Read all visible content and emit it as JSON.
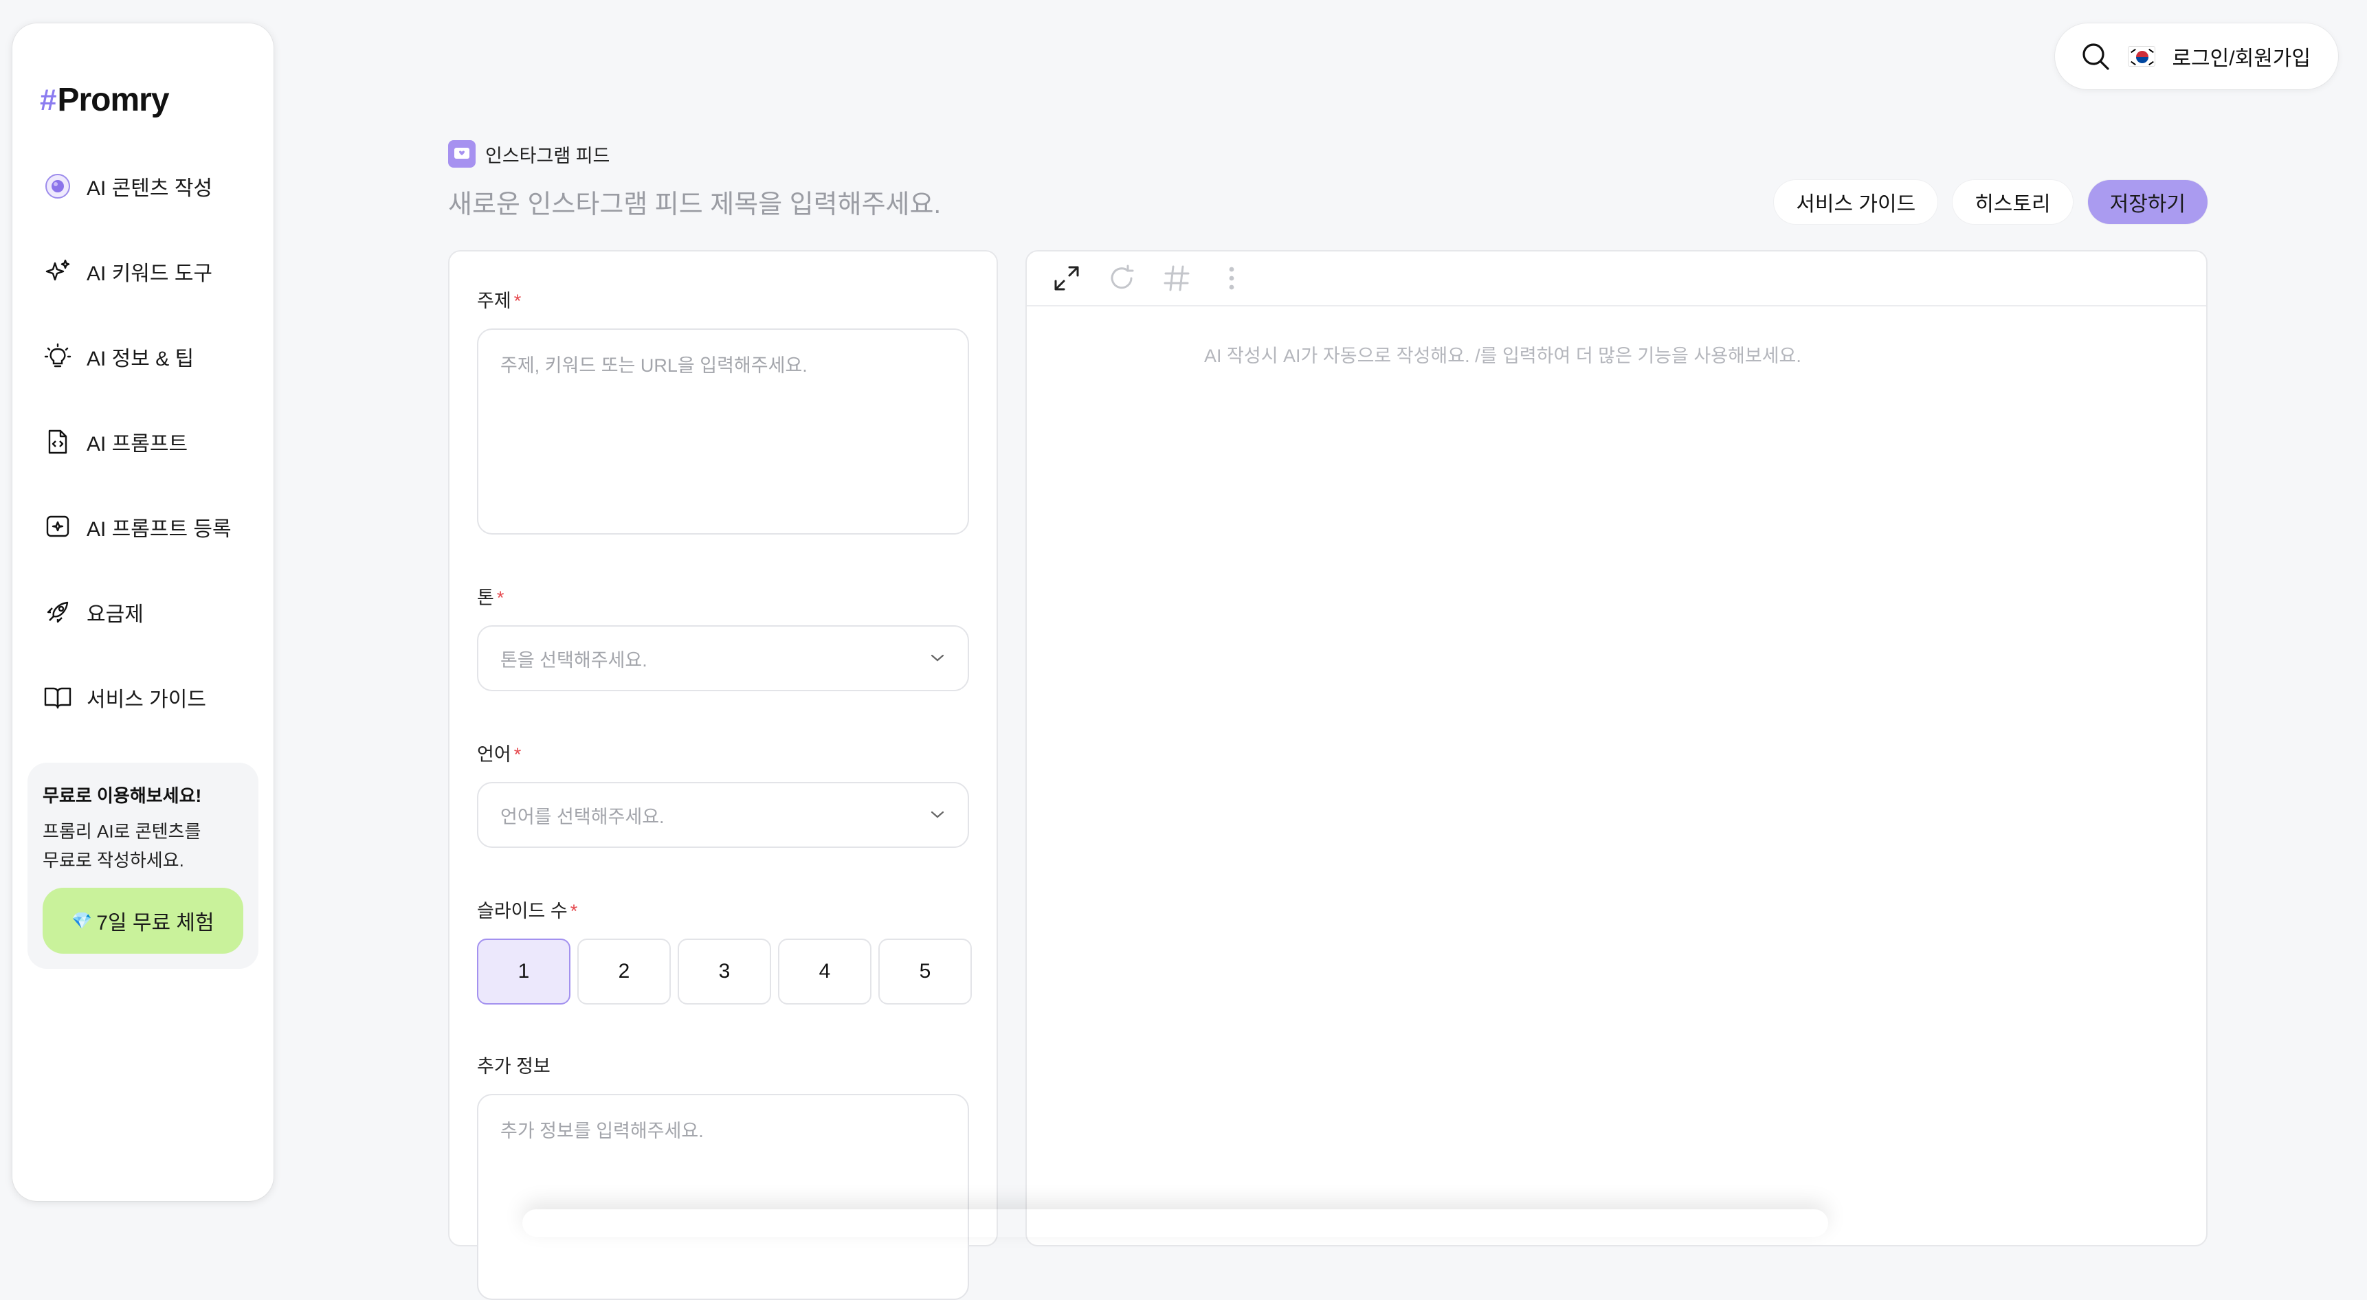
{
  "brand": {
    "hash": "#",
    "name": "Promry"
  },
  "sidebar": {
    "items": [
      {
        "label": "AI 콘텐츠 작성",
        "icon": "ai-content-icon"
      },
      {
        "label": "AI 키워드 도구",
        "icon": "sparkles-icon"
      },
      {
        "label": "AI 정보 & 팁",
        "icon": "lightbulb-icon"
      },
      {
        "label": "AI 프롬프트",
        "icon": "file-code-icon"
      },
      {
        "label": "AI 프롬프트 등록",
        "icon": "plus-square-icon"
      },
      {
        "label": "요금제",
        "icon": "rocket-icon"
      },
      {
        "label": "서비스 가이드",
        "icon": "book-icon"
      }
    ],
    "promo": {
      "title": "무료로 이용해보세요!",
      "desc": "프롬리 AI로 콘텐츠를 무료로 작성하세요.",
      "button_icon": "💎",
      "button_label": "7일 무료 체험"
    }
  },
  "topbar": {
    "flag": "kr-flag-icon",
    "login_label": "로그인/회원가입"
  },
  "page": {
    "type_label": "인스타그램 피드",
    "title_placeholder": "새로운 인스타그램 피드 제목을 입력해주세요.",
    "actions": {
      "guide": "서비스 가이드",
      "history": "히스토리",
      "save": "저장하기"
    }
  },
  "form": {
    "topic": {
      "label": "주제",
      "required": "*",
      "placeholder": "주제, 키워드 또는 URL을 입력해주세요."
    },
    "tone": {
      "label": "톤",
      "required": "*",
      "placeholder": "톤을 선택해주세요."
    },
    "language": {
      "label": "언어",
      "required": "*",
      "placeholder": "언어를 선택해주세요."
    },
    "slides": {
      "label": "슬라이드 수",
      "required": "*",
      "options": [
        "1",
        "2",
        "3",
        "4",
        "5"
      ],
      "selected": "1"
    },
    "extra": {
      "label": "추가 정보",
      "placeholder": "추가 정보를 입력해주세요."
    }
  },
  "editor": {
    "placeholder": "AI 작성시 AI가 자동으로 작성해요. /를 입력하여 더 많은 기능을 사용해보세요.",
    "tools": [
      "expand-icon",
      "refresh-icon",
      "hashtag-icon",
      "more-vertical-icon"
    ]
  },
  "colors": {
    "accent": "#aa9bf0",
    "trial": "#c9f29b",
    "required": "#e5484d"
  }
}
